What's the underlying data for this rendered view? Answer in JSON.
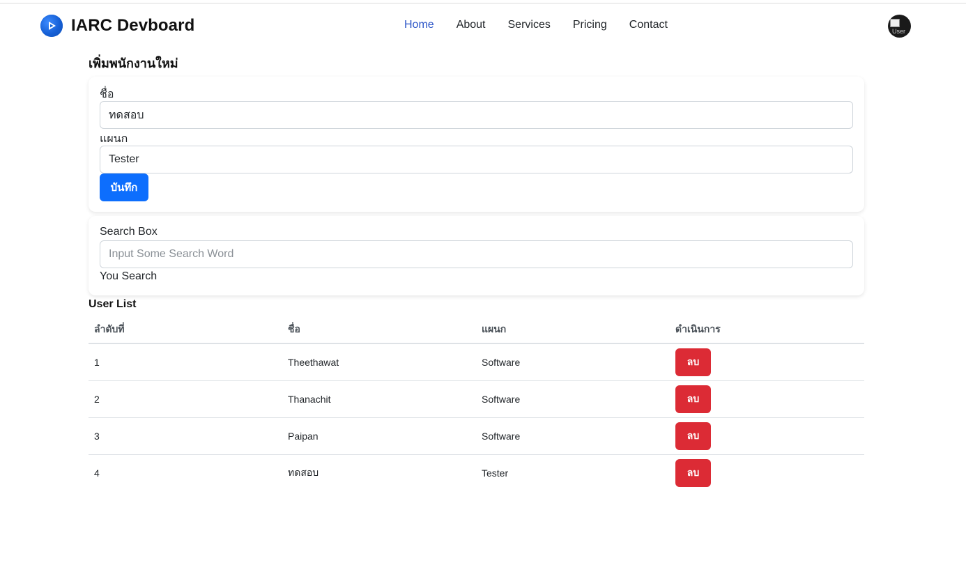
{
  "brand": {
    "name": "IARC Devboard",
    "logo_icon": "play-circle-icon",
    "accent": "#1565d8"
  },
  "nav": {
    "items": [
      {
        "label": "Home",
        "active": true
      },
      {
        "label": "About",
        "active": false
      },
      {
        "label": "Services",
        "active": false
      },
      {
        "label": "Pricing",
        "active": false
      },
      {
        "label": "Contact",
        "active": false
      }
    ]
  },
  "avatar": {
    "alt": "User"
  },
  "add_employee": {
    "title": "เพิ่มพนักงานใหม่",
    "name_label": "ชื่อ",
    "name_value": "ทดสอบ",
    "department_label": "แผนก",
    "department_value": "Tester",
    "save_label": "บันทึก"
  },
  "search": {
    "label": "Search Box",
    "placeholder": "Input Some Search Word",
    "value": "",
    "result_label": "You Search"
  },
  "user_list": {
    "title": "User List",
    "columns": [
      "ลำดับที่",
      "ชื่อ",
      "แผนก",
      "ดำเนินการ"
    ],
    "rows": [
      {
        "no": "1",
        "name": "Theethawat",
        "department": "Software",
        "action": "ลบ"
      },
      {
        "no": "2",
        "name": "Thanachit",
        "department": "Software",
        "action": "ลบ"
      },
      {
        "no": "3",
        "name": "Paipan",
        "department": "Software",
        "action": "ลบ"
      },
      {
        "no": "4",
        "name": "ทดสอบ",
        "department": "Tester",
        "action": "ลบ"
      }
    ]
  },
  "colors": {
    "primary": "#0d6efd",
    "danger": "#dc2b35",
    "nav_active": "#2b54c7"
  }
}
